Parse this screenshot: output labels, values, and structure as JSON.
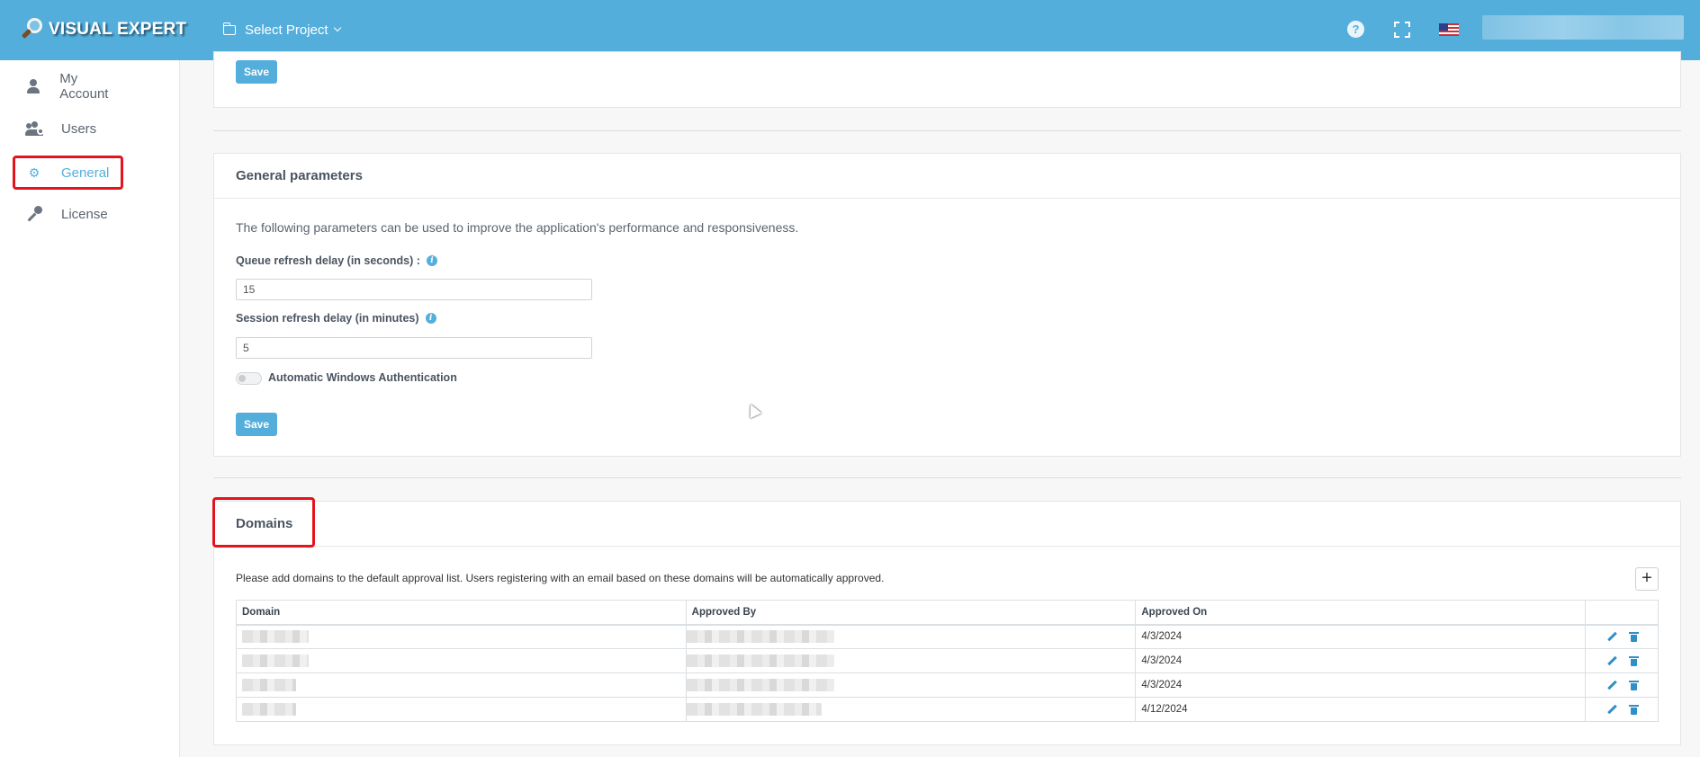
{
  "header": {
    "logo_text": "VISUAL EXPERT",
    "project_selector": "Select Project",
    "icons": [
      "help-icon",
      "fullscreen-icon",
      "us-flag-icon"
    ]
  },
  "sidebar": {
    "items": [
      {
        "label": "My Account",
        "icon": "user-icon",
        "active": false
      },
      {
        "label": "Users",
        "icon": "users-cog-icon",
        "active": false
      },
      {
        "label": "General",
        "icon": "gear-icon",
        "active": true
      },
      {
        "label": "License",
        "icon": "key-icon",
        "active": false
      }
    ]
  },
  "top_section": {
    "save_label": "Save"
  },
  "general_parameters": {
    "title": "General parameters",
    "description": "The following parameters can be used to improve the application's performance and responsiveness.",
    "queue_label": "Queue refresh delay (in seconds) :",
    "queue_value": "15",
    "session_label": "Session refresh delay (in minutes)",
    "session_value": "5",
    "windows_auth_label": "Automatic Windows Authentication",
    "windows_auth_enabled": false,
    "save_label": "Save"
  },
  "domains": {
    "title": "Domains",
    "description": "Please add domains to the default approval list. Users registering with an email based on these domains will be automatically approved.",
    "add_label": "+",
    "columns": [
      "Domain",
      "Approved By",
      "Approved On",
      ""
    ],
    "rows": [
      {
        "approved_on": "4/3/2024"
      },
      {
        "approved_on": "4/3/2024"
      },
      {
        "approved_on": "4/3/2024"
      },
      {
        "approved_on": "4/12/2024"
      }
    ]
  },
  "colors": {
    "accent": "#54aedc",
    "highlight": "#e3141c"
  }
}
